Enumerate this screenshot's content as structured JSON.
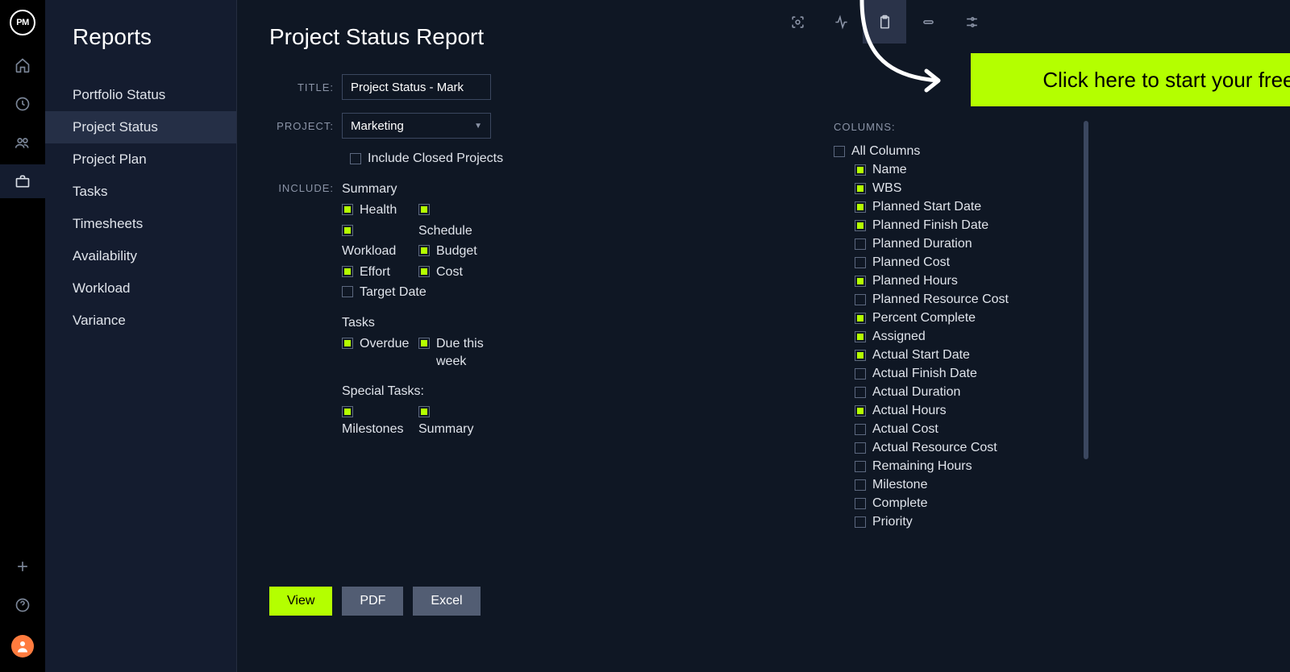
{
  "logo": "PM",
  "sidebar": {
    "title": "Reports",
    "items": [
      "Portfolio Status",
      "Project Status",
      "Project Plan",
      "Tasks",
      "Timesheets",
      "Availability",
      "Workload",
      "Variance"
    ],
    "selected": 1
  },
  "page": {
    "title": "Project Status Report",
    "labels": {
      "title": "TITLE:",
      "project": "PROJECT:",
      "include": "INCLUDE:",
      "columns": "COLUMNS:"
    },
    "title_value": "Project Status - Mark",
    "project_value": "Marketing",
    "include_closed": {
      "label": "Include Closed Projects",
      "checked": false
    },
    "include": {
      "summary_head": "Summary",
      "summary": [
        [
          {
            "label": "Health",
            "checked": true
          },
          {
            "label": "",
            "checked": true
          }
        ],
        [
          {
            "label": "Workload",
            "checked": true
          },
          {
            "label": "Schedule",
            "checked": false,
            "labelOnly": true
          }
        ],
        [
          {
            "label": "Effort",
            "checked": true
          },
          {
            "label": "Budget",
            "checked": true
          }
        ],
        [
          {
            "label": "Target Date",
            "checked": false
          },
          {
            "label": "Cost",
            "checked": true
          }
        ]
      ],
      "tasks_head": "Tasks",
      "tasks": [
        [
          {
            "label": "Overdue",
            "checked": true
          },
          {
            "label": "Due this week",
            "checked": true
          }
        ]
      ],
      "special_head": "Special Tasks:",
      "special": [
        [
          {
            "label": "Milestones",
            "checked": true
          },
          {
            "label": "Summary",
            "checked": true
          }
        ]
      ]
    },
    "columns": {
      "all_label": "All Columns",
      "all_checked": false,
      "items": [
        {
          "label": "Name",
          "checked": true
        },
        {
          "label": "WBS",
          "checked": true
        },
        {
          "label": "Planned Start Date",
          "checked": true
        },
        {
          "label": "Planned Finish Date",
          "checked": true
        },
        {
          "label": "Planned Duration",
          "checked": false
        },
        {
          "label": "Planned Cost",
          "checked": false
        },
        {
          "label": "Planned Hours",
          "checked": true
        },
        {
          "label": "Planned Resource Cost",
          "checked": false
        },
        {
          "label": "Percent Complete",
          "checked": true
        },
        {
          "label": "Assigned",
          "checked": true
        },
        {
          "label": "Actual Start Date",
          "checked": true
        },
        {
          "label": "Actual Finish Date",
          "checked": false
        },
        {
          "label": "Actual Duration",
          "checked": false
        },
        {
          "label": "Actual Hours",
          "checked": true
        },
        {
          "label": "Actual Cost",
          "checked": false
        },
        {
          "label": "Actual Resource Cost",
          "checked": false
        },
        {
          "label": "Remaining Hours",
          "checked": false
        },
        {
          "label": "Milestone",
          "checked": false
        },
        {
          "label": "Complete",
          "checked": false
        },
        {
          "label": "Priority",
          "checked": false
        }
      ]
    },
    "buttons": {
      "view": "View",
      "pdf": "PDF",
      "excel": "Excel"
    }
  },
  "cta": "Click here to start your free trial"
}
